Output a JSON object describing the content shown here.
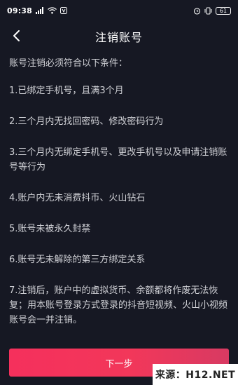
{
  "status_bar": {
    "time": "09:38",
    "battery": "61"
  },
  "header": {
    "title": "注销账号"
  },
  "content": {
    "intro": "账号注销必须符合以下条件：",
    "conditions": [
      "1.已绑定手机号，且满3个月",
      "2.三个月内无找回密码、修改密码行为",
      "3.三个月内无绑定手机号、更改手机号以及申请注销账号等行为",
      "4.账户内无未消费抖币、火山钻石",
      "5.账号未被永久封禁",
      "6.账号无未解除的第三方绑定关系",
      "7.注销后，账户中的虚拟货币、余额都将作废无法恢复；用本账号登录方式登录的抖音短视频、火山小视频账号会一并注销。"
    ]
  },
  "actions": {
    "next_label": "下一步"
  },
  "watermark": {
    "text": "来源：H12.NET"
  },
  "colors": {
    "background": "#161823",
    "accent": "#f5305c"
  }
}
